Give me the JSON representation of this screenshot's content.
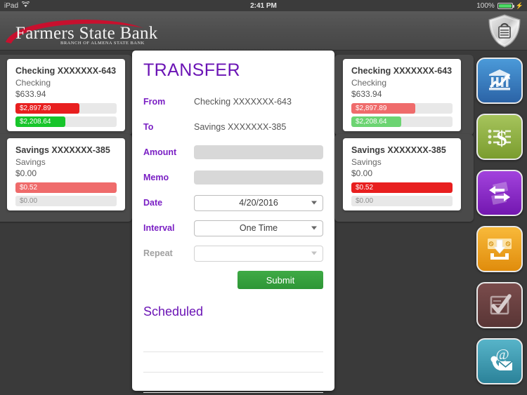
{
  "statusbar": {
    "device": "iPad",
    "wifi_icon": "wifi-icon",
    "time": "2:41 PM",
    "battery_percent": "100%",
    "battery_icon": "battery-full-icon",
    "charging_icon": "charging-bolt-icon"
  },
  "header": {
    "bank_name": "Farmers State Bank",
    "tagline": "BRANCH OF ALMENA STATE BANK",
    "shield_icon": "shield-lock-icon",
    "accent_red": "#c8102e"
  },
  "left_accounts": [
    {
      "title": "Checking XXXXXXX-643",
      "type": "Checking",
      "balance": "$633.94",
      "bars": [
        {
          "label": "$2,897.89",
          "color": "#e81f1f",
          "width_pct": 63,
          "label_dark": false
        },
        {
          "label": "$2,208.64",
          "color": "#17c52b",
          "width_pct": 49,
          "label_dark": false
        }
      ]
    },
    {
      "title": "Savings XXXXXXX-385",
      "type": "Savings",
      "balance": "$0.00",
      "bars": [
        {
          "label": "$0.52",
          "color": "#ef6b6b",
          "width_pct": 100,
          "label_dark": false
        },
        {
          "label": "$0.00",
          "color": "#e8e8e8",
          "width_pct": 100,
          "label_dark": true
        }
      ]
    }
  ],
  "right_accounts": [
    {
      "title": "Checking XXXXXXX-643",
      "type": "Checking",
      "balance": "$633.94",
      "bars": [
        {
          "label": "$2,897.89",
          "color": "#ef6b6b",
          "width_pct": 63,
          "label_dark": false
        },
        {
          "label": "$2,208.64",
          "color": "#6cd472",
          "width_pct": 49,
          "label_dark": false
        }
      ]
    },
    {
      "title": "Savings XXXXXXX-385",
      "type": "Savings",
      "balance": "$0.00",
      "bars": [
        {
          "label": "$0.52",
          "color": "#e81f1f",
          "width_pct": 100,
          "label_dark": false
        },
        {
          "label": "$0.00",
          "color": "#e8e8e8",
          "width_pct": 100,
          "label_dark": true
        }
      ]
    }
  ],
  "transfer": {
    "title": "TRANSFER",
    "accent_purple": "#6b14b5",
    "from_label": "From",
    "from_value": "Checking XXXXXXX-643",
    "to_label": "To",
    "to_value": "Savings XXXXXXX-385",
    "amount_label": "Amount",
    "amount_value": "",
    "amount_placeholder": "",
    "memo_label": "Memo",
    "memo_value": "",
    "memo_placeholder": "",
    "date_label": "Date",
    "date_value": "4/20/2016",
    "interval_label": "Interval",
    "interval_value": "One Time",
    "repeat_label": "Repeat",
    "repeat_value": "",
    "submit_label": "Submit",
    "submit_color": "#2e9636",
    "scheduled_title": "Scheduled"
  },
  "nav_buttons": [
    {
      "name": "accounts",
      "icon": "bank-chart-icon",
      "color_top": "#3f8fd0",
      "color_bottom": "#2f6fb0"
    },
    {
      "name": "transactions",
      "icon": "dollar-list-icon",
      "color_top": "#9cba52",
      "color_bottom": "#7ea033"
    },
    {
      "name": "transfer",
      "icon": "transfer-arrows-icon",
      "color_top": "#9b3fd4",
      "color_bottom": "#7a20b4"
    },
    {
      "name": "deposit",
      "icon": "deposit-icon",
      "color_top": "#f6b32a",
      "color_bottom": "#e08c0c"
    },
    {
      "name": "checks",
      "icon": "check-mark-icon",
      "color_top": "#6e4545",
      "color_bottom": "#5a3636"
    },
    {
      "name": "contact",
      "icon": "contact-mail-icon",
      "color_top": "#4fa8bd",
      "color_bottom": "#2f8ba3"
    }
  ]
}
